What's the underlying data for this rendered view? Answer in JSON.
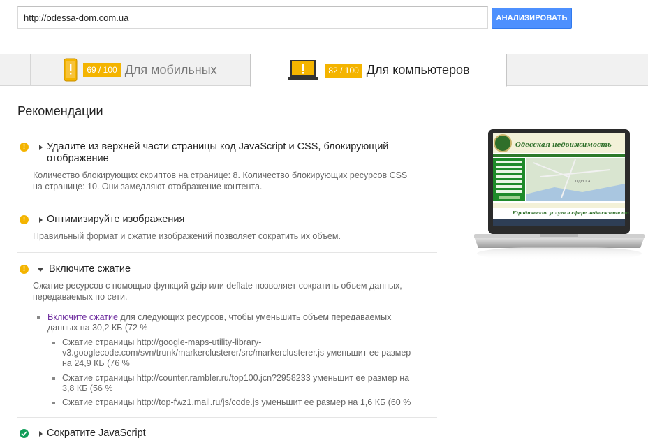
{
  "search": {
    "url_value": "http://odessa-dom.com.ua",
    "analyze_label": "АНАЛИЗИРОВАТЬ"
  },
  "tabs": {
    "mobile": {
      "score": "69 / 100",
      "label": "Для мобильных"
    },
    "desktop": {
      "score": "82 / 100",
      "label": "Для компьютеров"
    }
  },
  "content": {
    "title": "Рекомендации",
    "rec1": {
      "title_line1": "Удалите из верхней части страницы код JavaScript и CSS, блокирующий",
      "title_line2": "отображение",
      "desc_line1": "Количество блокирующих скриптов на странице: 8. Количество блокирующих ресурсов CSS",
      "desc_line2": "на странице: 10. Они замедляют отображение контента."
    },
    "rec2": {
      "title": "Оптимизируйте изображения",
      "desc": "Правильный формат и сжатие изображений позволяет сократить их объем."
    },
    "rec3": {
      "title": "Включите сжатие",
      "desc_line1": "Сжатие ресурсов с помощью функций gzip или deflate позволяет сократить объем данных,",
      "desc_line2": "передаваемых по сети.",
      "bullet_link": "Включите сжатие",
      "bullet_rest": " для следующих ресурсов, чтобы уменьшить объем передаваемых",
      "bullet_line2": "данных на 30,2 КБ (72 %",
      "items": [
        {
          "line1": "Сжатие страницы http://google-maps-utility-library-",
          "line2": "v3.googlecode.com/svn/trunk/markerclusterer/src/markerclusterer.js уменьшит ее размер",
          "line3": "на 24,9 КБ (76 %"
        },
        {
          "line1": "Сжатие страницы http://counter.rambler.ru/top100.jcn?2958233 уменьшит ее размер на",
          "line2": "3,8 КБ (56 %"
        },
        {
          "line1": "Сжатие страницы http://top-fwz1.mail.ru/js/code.js уменьшит ее размер на 1,6 КБ (60 %"
        }
      ]
    },
    "rec4": {
      "title": "Сократите JavaScript"
    }
  },
  "preview": {
    "site_title": "Одесская недвижимость",
    "banner": "Юридические услуги в сфере недвижимости",
    "map_label": "ОДЕССА"
  },
  "colors": {
    "accent_blue": "#4d90fe",
    "warning": "#f4b400",
    "success": "#0f9d58",
    "link": "#7030a0"
  }
}
